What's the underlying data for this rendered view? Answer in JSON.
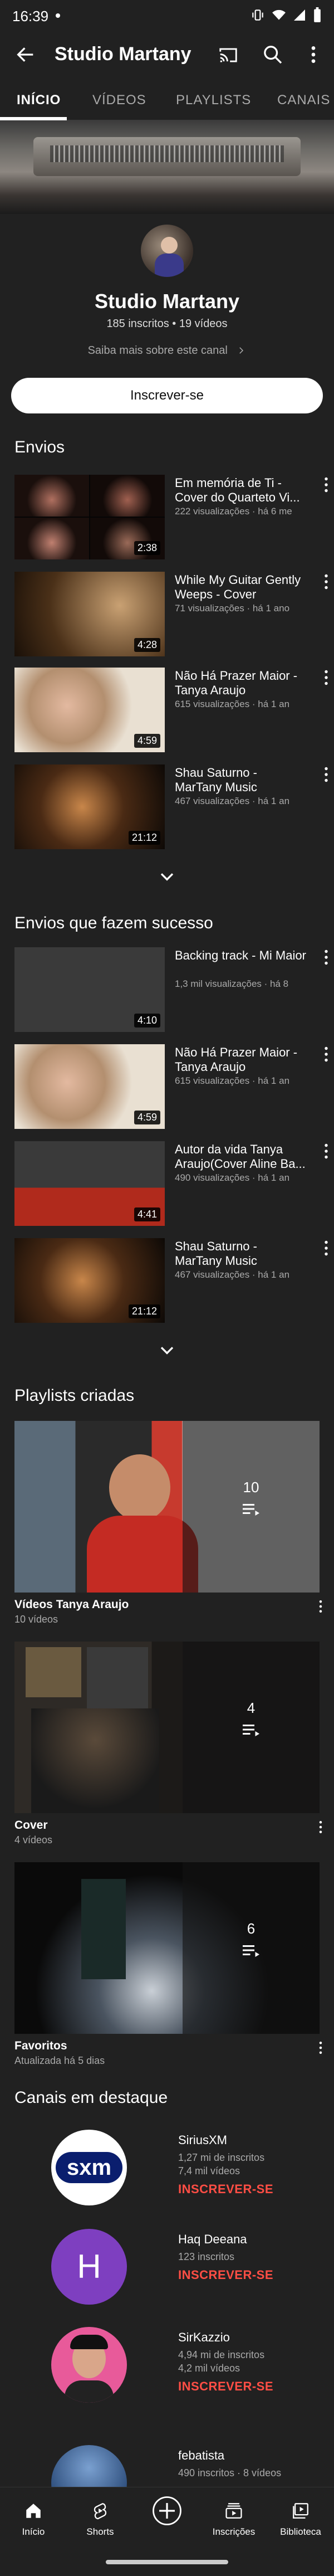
{
  "status_bar": {
    "time": "16:39"
  },
  "app_bar": {
    "title": "Studio Martany"
  },
  "tabs": [
    {
      "label": "INÍCIO",
      "active": true
    },
    {
      "label": "VÍDEOS",
      "active": false
    },
    {
      "label": "PLAYLISTS",
      "active": false
    },
    {
      "label": "CANAIS",
      "active": false
    }
  ],
  "channel": {
    "name": "Studio Martany",
    "stats": "185 inscritos • 19 vídeos",
    "about_link": "Saiba mais sobre este canal",
    "subscribe_label": "Inscrever-se"
  },
  "uploads": {
    "title": "Envios",
    "videos": [
      {
        "title": "Em memória de Ti - Cover do Quarteto Vi...",
        "meta": "222 visualizações · há 6 me",
        "duration": "2:38"
      },
      {
        "title": "While My Guitar Gently Weeps - Cover",
        "meta": "71 visualizações · há 1 ano",
        "duration": "4:28"
      },
      {
        "title": "Não Há Prazer Maior - Tanya Araujo",
        "meta": "615 visualizações · há 1 an",
        "duration": "4:59"
      },
      {
        "title": "Shau Saturno - MarTany Music",
        "meta": "467 visualizações · há 1 an",
        "duration": "21:12"
      }
    ]
  },
  "popular": {
    "title": "Envios que fazem sucesso",
    "videos": [
      {
        "title": "Backing track - Mi Maior",
        "meta": "1,3 mil visualizações · há 8",
        "duration": "4:10"
      },
      {
        "title": "Não Há Prazer Maior - Tanya Araujo",
        "meta": "615 visualizações · há 1 an",
        "duration": "4:59"
      },
      {
        "title": "Autor da vida   Tanya Araujo(Cover Aline Ba...",
        "meta": "490 visualizações · há 1 an",
        "duration": "4:41"
      },
      {
        "title": "Shau Saturno - MarTany Music",
        "meta": "467 visualizações · há 1 an",
        "duration": "21:12"
      }
    ]
  },
  "playlists": {
    "title": "Playlists criadas",
    "items": [
      {
        "name": "Vídeos Tanya Araujo",
        "sub": "10 vídeos",
        "count": "10"
      },
      {
        "name": "Cover",
        "sub": "4 vídeos",
        "count": "4"
      },
      {
        "name": "Favoritos",
        "sub": "Atualizada há 5 dias",
        "count": "6"
      }
    ]
  },
  "featured_channels": {
    "title": "Canais em destaque",
    "items": [
      {
        "name": "SiriusXM",
        "subscribers": "1,27 mi de inscritos",
        "videos": "7,4 mil vídeos",
        "subscribe": "INSCREVER-SE",
        "avatar_text": "sxm"
      },
      {
        "name": "Haq Deeana",
        "subscribers": "123 inscritos",
        "subscribe": "INSCREVER-SE",
        "avatar_text": "H"
      },
      {
        "name": "SirKazzio",
        "subscribers": "4,94 mi de inscritos",
        "videos": "4,2 mil vídeos",
        "subscribe": "INSCREVER-SE"
      },
      {
        "name": "febatista",
        "subscribers": "490 inscritos · 8 vídeos"
      }
    ]
  },
  "bottom_nav": [
    {
      "label": "Início",
      "icon": "home-icon"
    },
    {
      "label": "Shorts",
      "icon": "shorts-icon"
    },
    {
      "label": "",
      "icon": "create-icon"
    },
    {
      "label": "Inscrições",
      "icon": "subscriptions-icon"
    },
    {
      "label": "Biblioteca",
      "icon": "library-icon"
    }
  ],
  "colors": {
    "background": "#212121",
    "accent_red": "#ff4e45",
    "muted_text": "#aaaaaa"
  }
}
